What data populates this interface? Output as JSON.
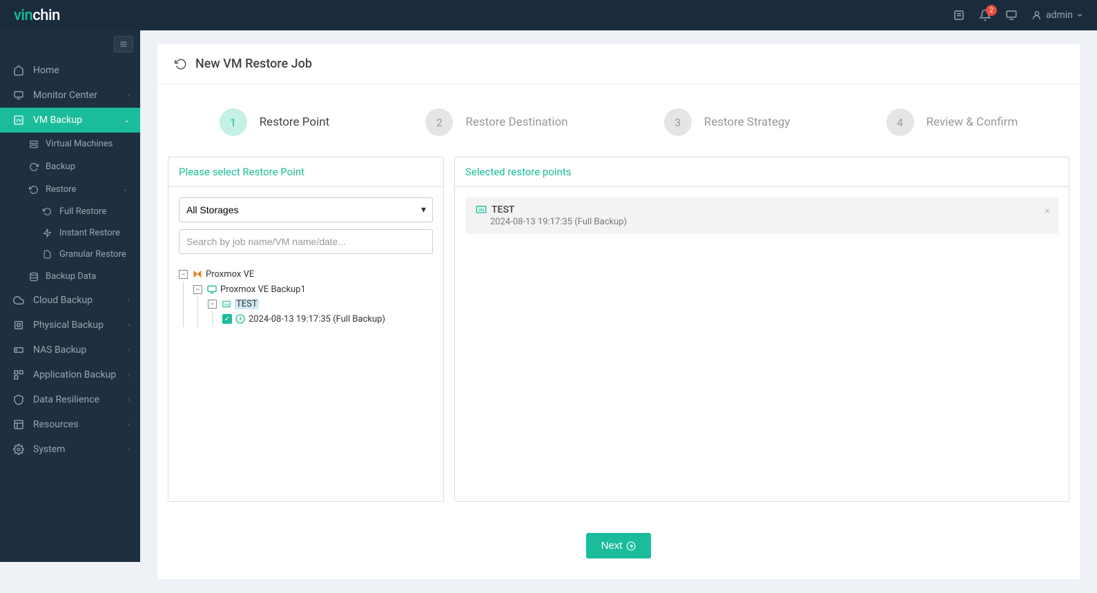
{
  "logo": {
    "part1": "vin",
    "part2": "chin"
  },
  "topbar": {
    "notif_count": "2",
    "user": "admin"
  },
  "sidebar": {
    "home": "Home",
    "monitor": "Monitor Center",
    "vmbackup": "VM Backup",
    "vmbackup_children": {
      "vms": "Virtual Machines",
      "backup": "Backup",
      "restore": "Restore",
      "restore_children": {
        "full": "Full Restore",
        "instant": "Instant Restore",
        "granular": "Granular Restore"
      },
      "backupdata": "Backup Data"
    },
    "cloud": "Cloud Backup",
    "physical": "Physical Backup",
    "nas": "NAS Backup",
    "app": "Application Backup",
    "datares": "Data Resilience",
    "resources": "Resources",
    "system": "System"
  },
  "page": {
    "title": "New VM Restore Job"
  },
  "steps": {
    "s1": {
      "num": "1",
      "label": "Restore Point"
    },
    "s2": {
      "num": "2",
      "label": "Restore Destination"
    },
    "s3": {
      "num": "3",
      "label": "Restore Strategy"
    },
    "s4": {
      "num": "4",
      "label": "Review & Confirm"
    }
  },
  "left_panel": {
    "title": "Please select Restore Point",
    "storage_selected": "All Storages",
    "search_placeholder": "Search by job name/VM name/date...",
    "tree": {
      "root": "Proxmox VE",
      "job": "Proxmox VE Backup1",
      "vm": "TEST",
      "point": "2024-08-13 19:17:35 (Full  Backup)"
    }
  },
  "right_panel": {
    "title": "Selected restore points",
    "item": {
      "name": "TEST",
      "detail": "2024-08-13 19:17:35 (Full Backup)"
    }
  },
  "footer": {
    "next": "Next"
  }
}
